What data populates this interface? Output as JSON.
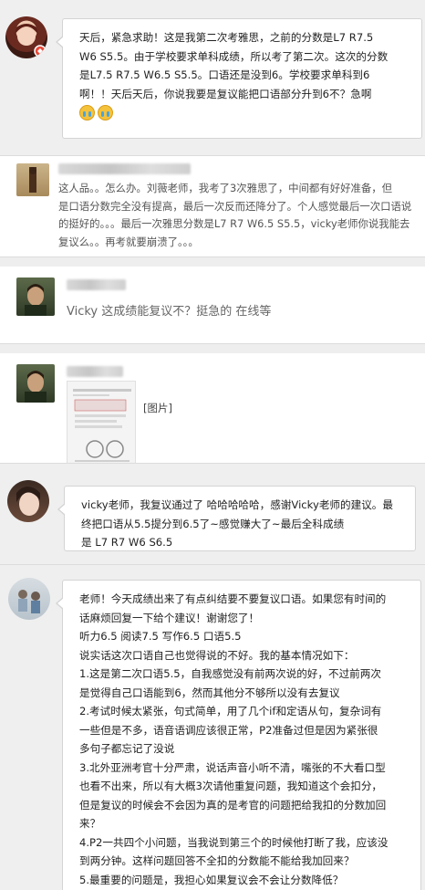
{
  "comments": [
    {
      "id": "c1",
      "lines": [
        "天后，紧急求助！这是我第二次考雅思，之前的分数是L7 R7.5",
        "W6 S5.5。由于学校要求单科成绩，所以考了第二次。这次的分数",
        "是L7.5 R7.5 W6.5 S5.5。口语还是没到6。学校要求单科到6",
        "啊！！天后天后，你说我要是复议能把口语部分升到6不？急啊"
      ],
      "emoji_icons": [
        "crying-face-icon",
        "crying-face-icon"
      ]
    },
    {
      "id": "c2",
      "lines": [
        "这人品。。怎么办。刘薇老师，我考了3次雅思了，中间都有好好准备，但",
        "是口语分数完全没有提高，最后一次反而还降分了。个人感觉最后一次口语说",
        "的挺好的。。。最后一次雅思分数是L7 R7 W6.5 S5.5，vicky老师你说我能去",
        "复议么。。再考就要崩溃了。。。"
      ]
    },
    {
      "id": "c3",
      "text": "Vicky 这成绩能复议不？挺急的 在线等"
    },
    {
      "id": "c4",
      "image_label": "[图片]"
    },
    {
      "id": "c5",
      "lines": [
        "vicky老师，我复议通过了 哈哈哈哈哈，感谢Vicky老师的建议。最",
        "终把口语从5.5提分到6.5了~感觉赚大了~最后全科成绩",
        "是 L7 R7 W6 S6.5"
      ]
    },
    {
      "id": "c6",
      "lines": [
        "老师！今天成绩出来了有点纠结要不要复议口语。如果您有时间的",
        "话麻烦回复一下给个建议！谢谢您了！",
        "听力6.5 阅读7.5 写作6.5 口语5.5",
        "说实话这次口语自己也觉得说的不好。我的基本情况如下：",
        "1.这是第二次口语5.5，自我感觉没有前两次说的好，不过前两次",
        "是觉得自己口语能到6，然而其他分不够所以没有去复议",
        "2.考试时候太紧张，句式简单，用了几个if和定语从句，复杂词有",
        "一些但是不多，语音语调应该很正常，P2准备过但是因为紧张很",
        "多句子都忘记了没说",
        "3.北外亚洲考官十分严肃，说话声音小听不清，嘴张的不大看口型",
        "也看不出来，所以有大概3次请他重复问题，我知道这个会扣分，",
        "但是复议的时候会不会因为真的是考官的问题把给我扣的分数加回",
        "来？",
        "4.P2一共四个小问题，当我说到第三个的时候他打断了我，应该没",
        "到两分钟。这样问题回答不全扣的分数能不能给我加回来？",
        "5.最重要的问题是，我担心如果复议会不会让分数降低？"
      ]
    }
  ]
}
